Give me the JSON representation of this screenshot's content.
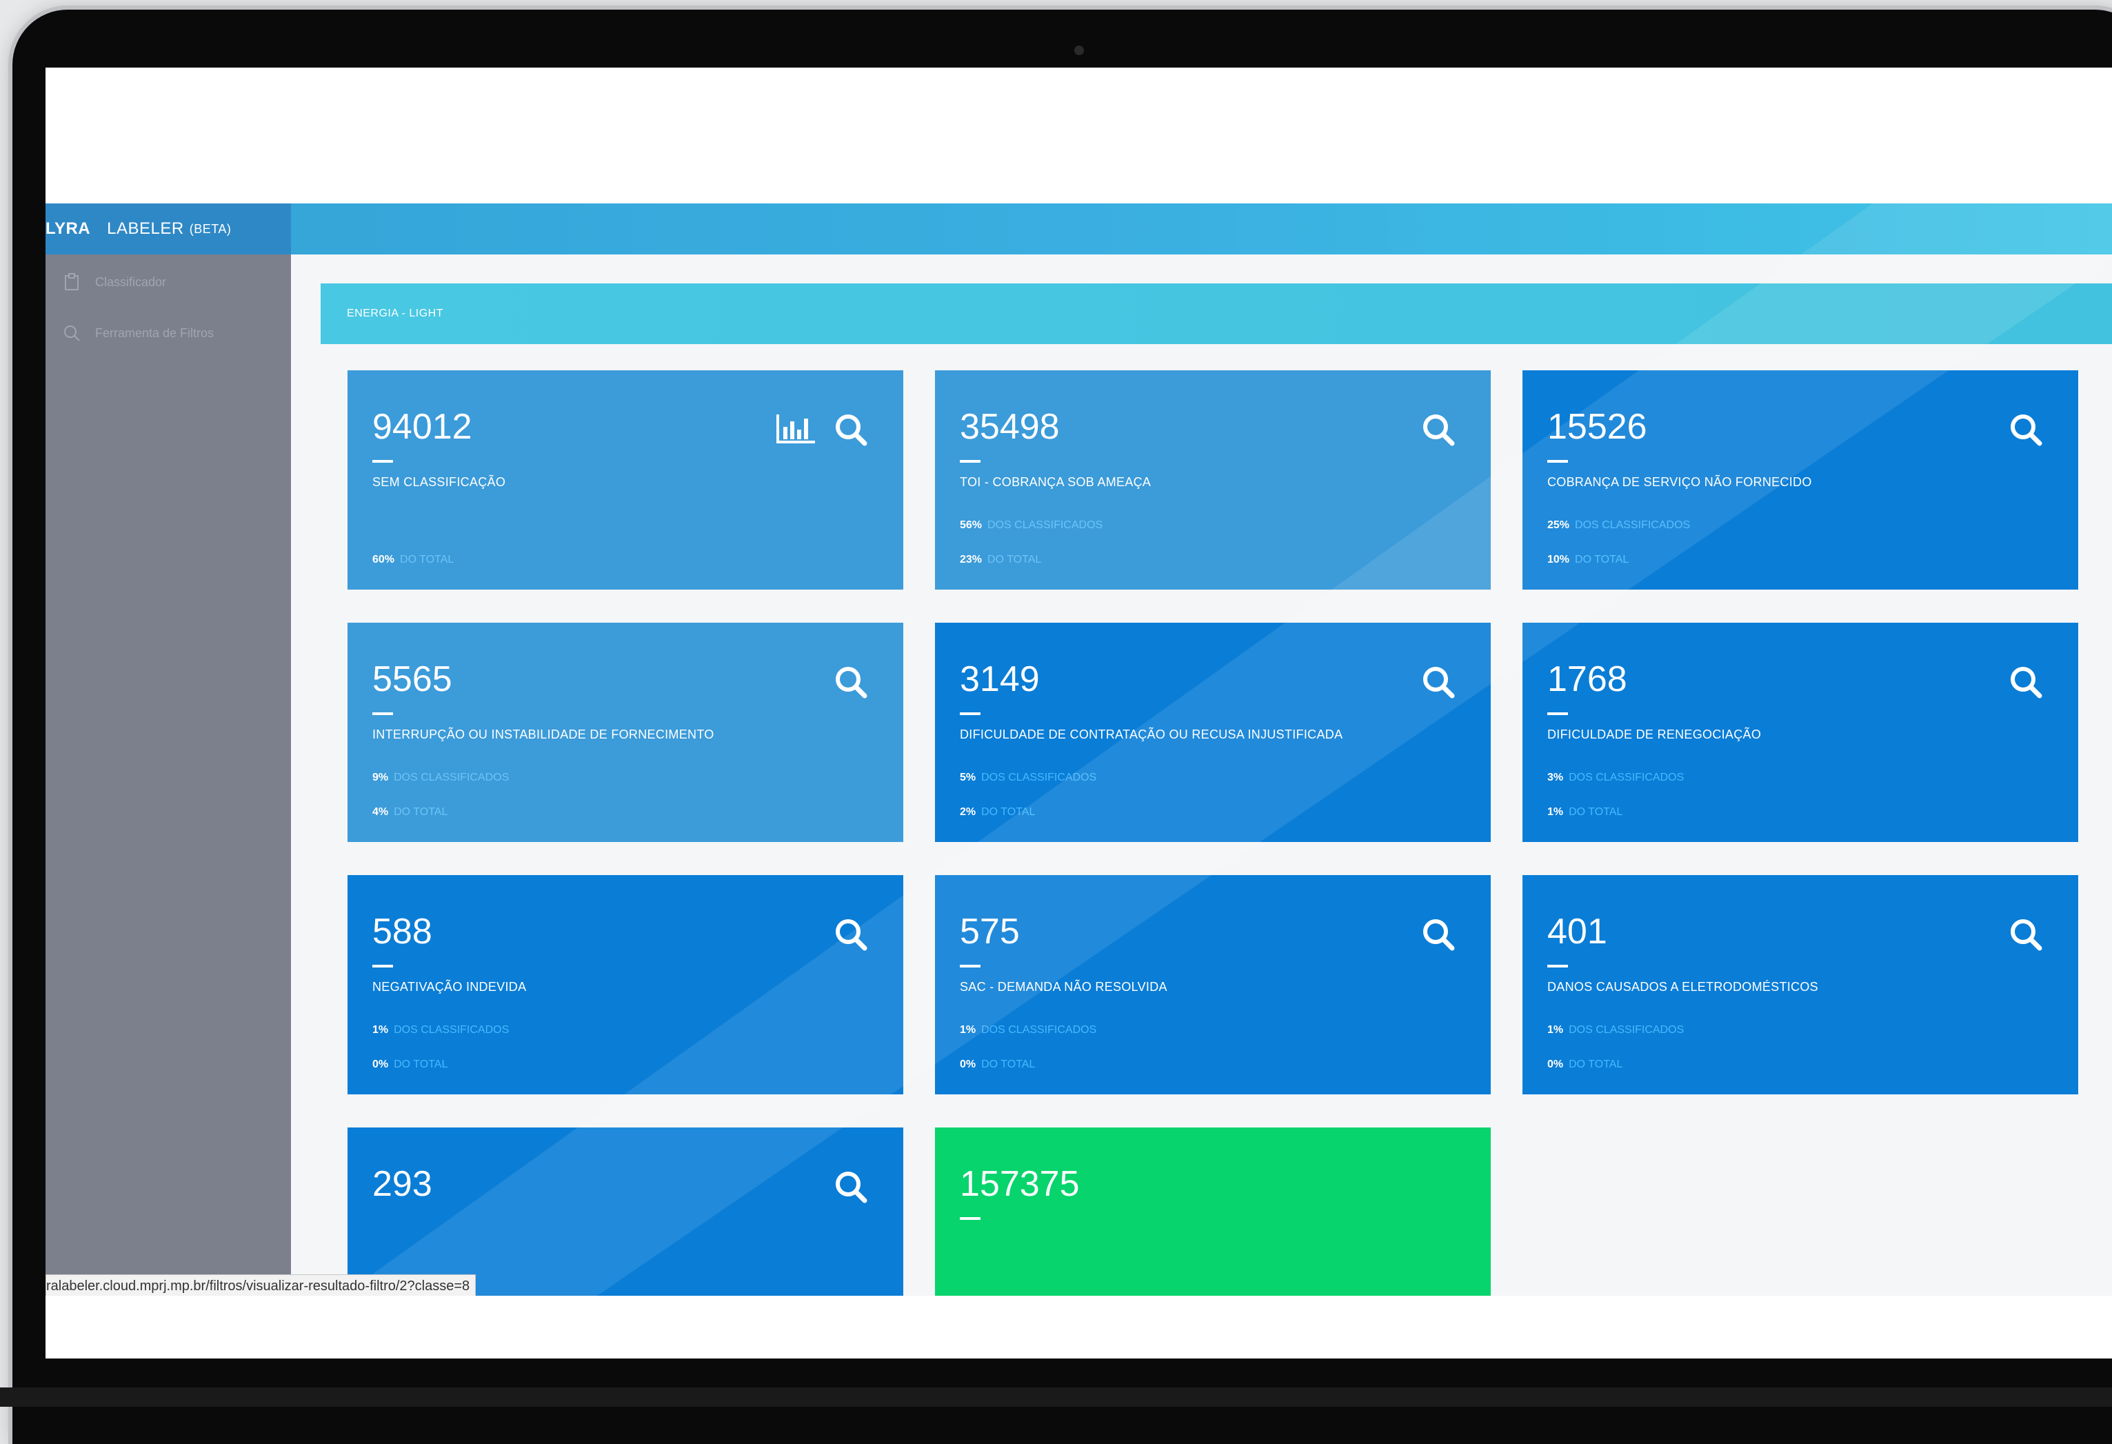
{
  "app": {
    "brand_name": "LYRA",
    "product": "LABELER",
    "beta": "(BETA)"
  },
  "sidebar": {
    "items": [
      {
        "label": "Classificador",
        "icon": "clipboard-icon"
      },
      {
        "label": "Ferramenta de Filtros",
        "icon": "search-icon"
      }
    ]
  },
  "section": {
    "title": "ENERGIA - LIGHT"
  },
  "cards": [
    {
      "value": "94012",
      "label": "SEM CLASSIFICAÇÃO",
      "pct_total": "60%",
      "total_label": "DO TOTAL"
    },
    {
      "value": "35498",
      "label": "TOI - COBRANÇA SOB AMEAÇA",
      "pct_class": "56%",
      "class_label": "DOS CLASSIFICADOS",
      "pct_total": "23%",
      "total_label": "DO TOTAL"
    },
    {
      "value": "15526",
      "label": "COBRANÇA DE SERVIÇO NÃO FORNECIDO",
      "pct_class": "25%",
      "class_label": "DOS CLASSIFICADOS",
      "pct_total": "10%",
      "total_label": "DO TOTAL"
    },
    {
      "value": "5565",
      "label": "INTERRUPÇÃO OU INSTABILIDADE DE FORNECIMENTO",
      "pct_class": "9%",
      "class_label": "DOS CLASSIFICADOS",
      "pct_total": "4%",
      "total_label": "DO TOTAL"
    },
    {
      "value": "3149",
      "label": "DIFICULDADE DE CONTRATAÇÃO OU RECUSA INJUSTIFICADA",
      "pct_class": "5%",
      "class_label": "DOS CLASSIFICADOS",
      "pct_total": "2%",
      "total_label": "DO TOTAL"
    },
    {
      "value": "1768",
      "label": "DIFICULDADE DE RENEGOCIAÇÃO",
      "pct_class": "3%",
      "class_label": "DOS CLASSIFICADOS",
      "pct_total": "1%",
      "total_label": "DO TOTAL"
    },
    {
      "value": "588",
      "label": "NEGATIVAÇÃO INDEVIDA",
      "pct_class": "1%",
      "class_label": "DOS CLASSIFICADOS",
      "pct_total": "0%",
      "total_label": "DO TOTAL"
    },
    {
      "value": "575",
      "label": "SAC - DEMANDA NÃO RESOLVIDA",
      "pct_class": "1%",
      "class_label": "DOS CLASSIFICADOS",
      "pct_total": "0%",
      "total_label": "DO TOTAL"
    },
    {
      "value": "401",
      "label": "DANOS CAUSADOS A ELETRODOMÉSTICOS",
      "pct_class": "1%",
      "class_label": "DOS CLASSIFICADOS",
      "pct_total": "0%",
      "total_label": "DO TOTAL"
    },
    {
      "value": "293"
    },
    {
      "value": "157375"
    }
  ],
  "status_url": "ralabeler.cloud.mprj.mp.br/filtros/visualizar-resultado-filtro/2?classe=8",
  "colors": {
    "card_blue": "#0a7dd6",
    "card_light": "#3c9bd9",
    "card_green": "#07d46c",
    "topbar": "#3aaee0",
    "sidebar": "#7c7f8c"
  }
}
